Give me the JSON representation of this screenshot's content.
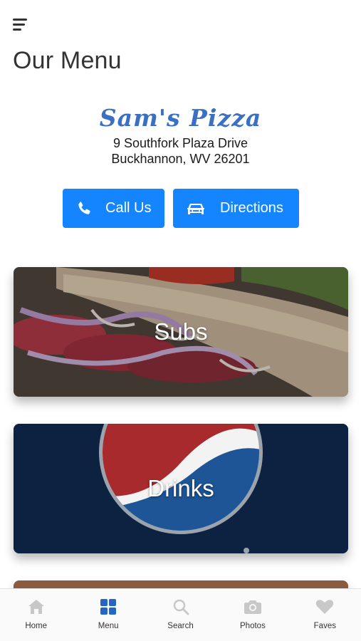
{
  "header": {
    "page_title": "Our Menu",
    "menu_icon": "hamburger-icon"
  },
  "restaurant": {
    "name": "Sam's Pizza",
    "address_line1": "9 Southfork Plaza Drive",
    "address_line2": "Buckhannon, WV 26201"
  },
  "actions": {
    "call_label": "Call Us",
    "call_icon": "phone-icon",
    "directions_label": "Directions",
    "directions_icon": "car-icon",
    "accent_color": "#1485ff"
  },
  "categories": [
    {
      "label": "Subs"
    },
    {
      "label": "Drinks"
    }
  ],
  "tabbar": {
    "items": [
      {
        "label": "Home",
        "icon": "home-icon",
        "active": false
      },
      {
        "label": "Menu",
        "icon": "grid-icon",
        "active": true
      },
      {
        "label": "Search",
        "icon": "search-icon",
        "active": false
      },
      {
        "label": "Photos",
        "icon": "camera-icon",
        "active": false
      },
      {
        "label": "Faves",
        "icon": "heart-icon",
        "active": false
      }
    ],
    "active_color": "#2566c2",
    "inactive_color": "#c8c8c8"
  }
}
